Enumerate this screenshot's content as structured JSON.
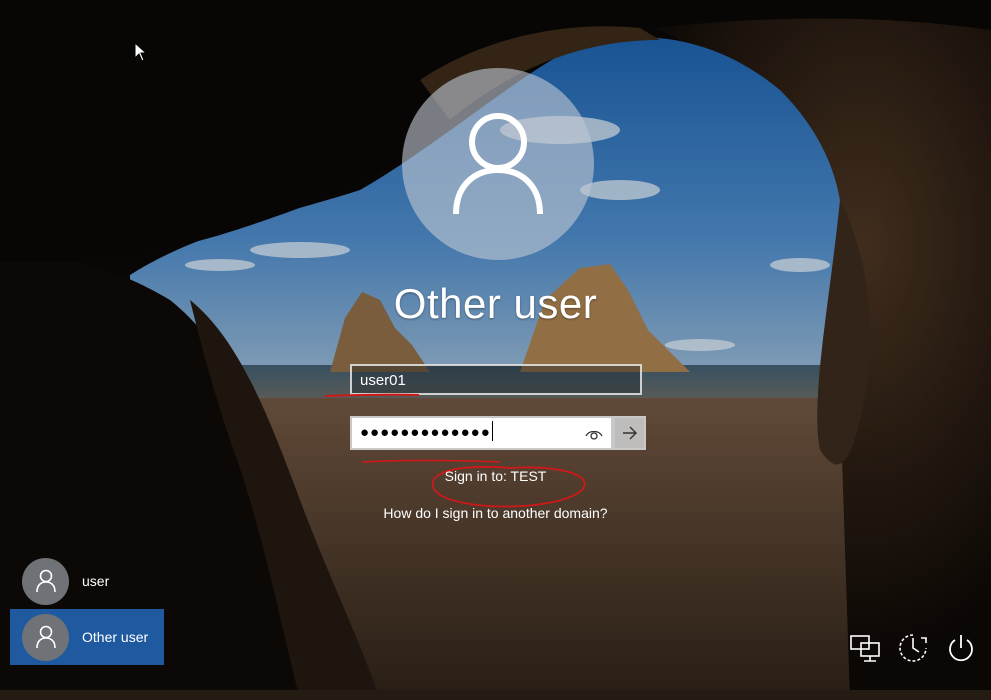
{
  "login": {
    "title": "Other user",
    "username_value": "user01",
    "password_mask": "●●●●●●●●●●●●●",
    "sign_in_to": "Sign in to: TEST",
    "domain_help_link": "How do I sign in to another domain?"
  },
  "user_list": [
    {
      "label": "user",
      "selected": false
    },
    {
      "label": "Other user",
      "selected": true
    }
  ],
  "system_icons": [
    "network-icon",
    "ease-of-access-icon",
    "power-icon"
  ],
  "colors": {
    "selected_tile": "#1f5aa0",
    "annotation_red": "#d01818",
    "text": "#ffffff"
  }
}
